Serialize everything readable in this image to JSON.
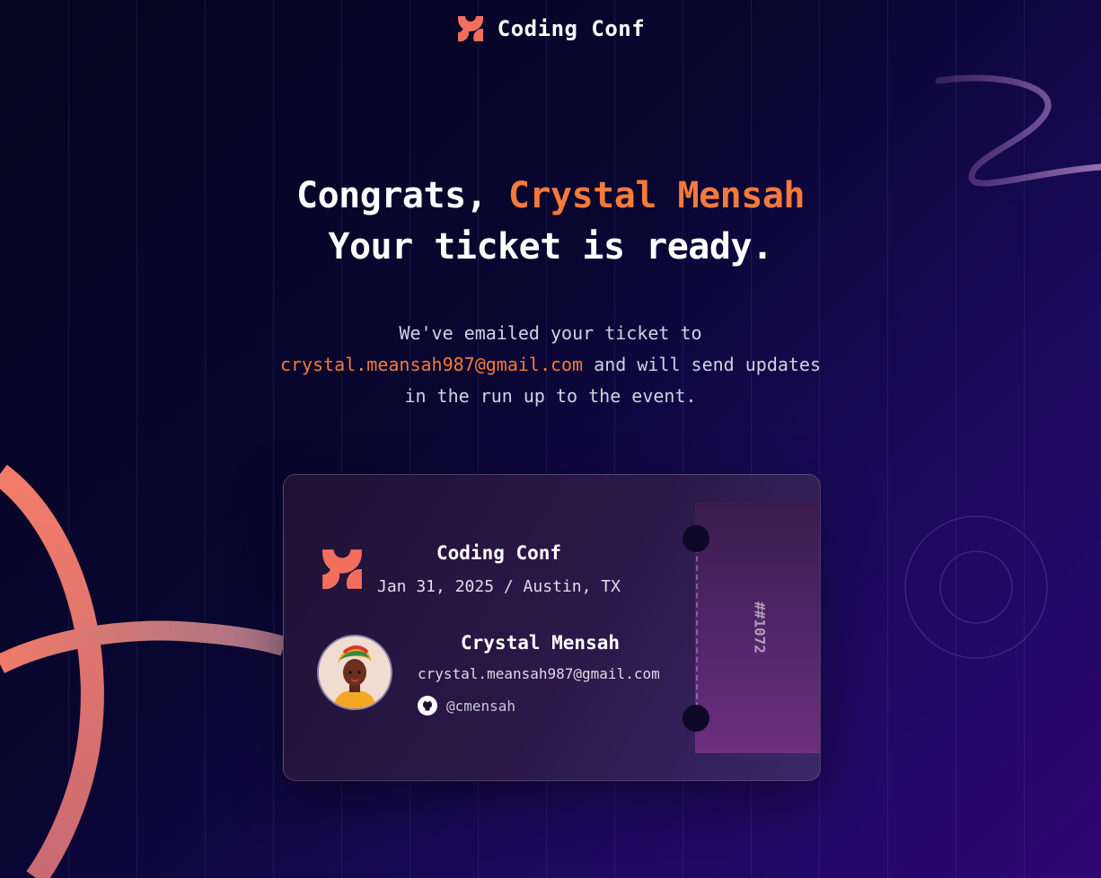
{
  "header": {
    "brand": "Coding Conf",
    "logo": "coding-conf-logo-icon"
  },
  "hero": {
    "congrats_prefix": "Congrats,",
    "name": "Crystal Mensah",
    "line2": "Your ticket is ready."
  },
  "message": {
    "line1": "We've emailed your ticket to",
    "email": "crystal.meansah987@gmail.com",
    "line2_rest": "and will send updates",
    "line3": "in the run up to the event."
  },
  "ticket": {
    "title": "Coding Conf",
    "meta": "Jan 31, 2025 / Austin, TX",
    "attendee_name": "Crystal Mensah",
    "attendee_email": "crystal.meansah987@gmail.com",
    "github_handle": "@cmensah",
    "github_icon": "github-icon",
    "number": "##1072"
  },
  "colors": {
    "accent_orange": "#f57a3a",
    "logo_coral": "#f26f5e",
    "background_start": "#06041f",
    "background_end": "#2e0673"
  }
}
